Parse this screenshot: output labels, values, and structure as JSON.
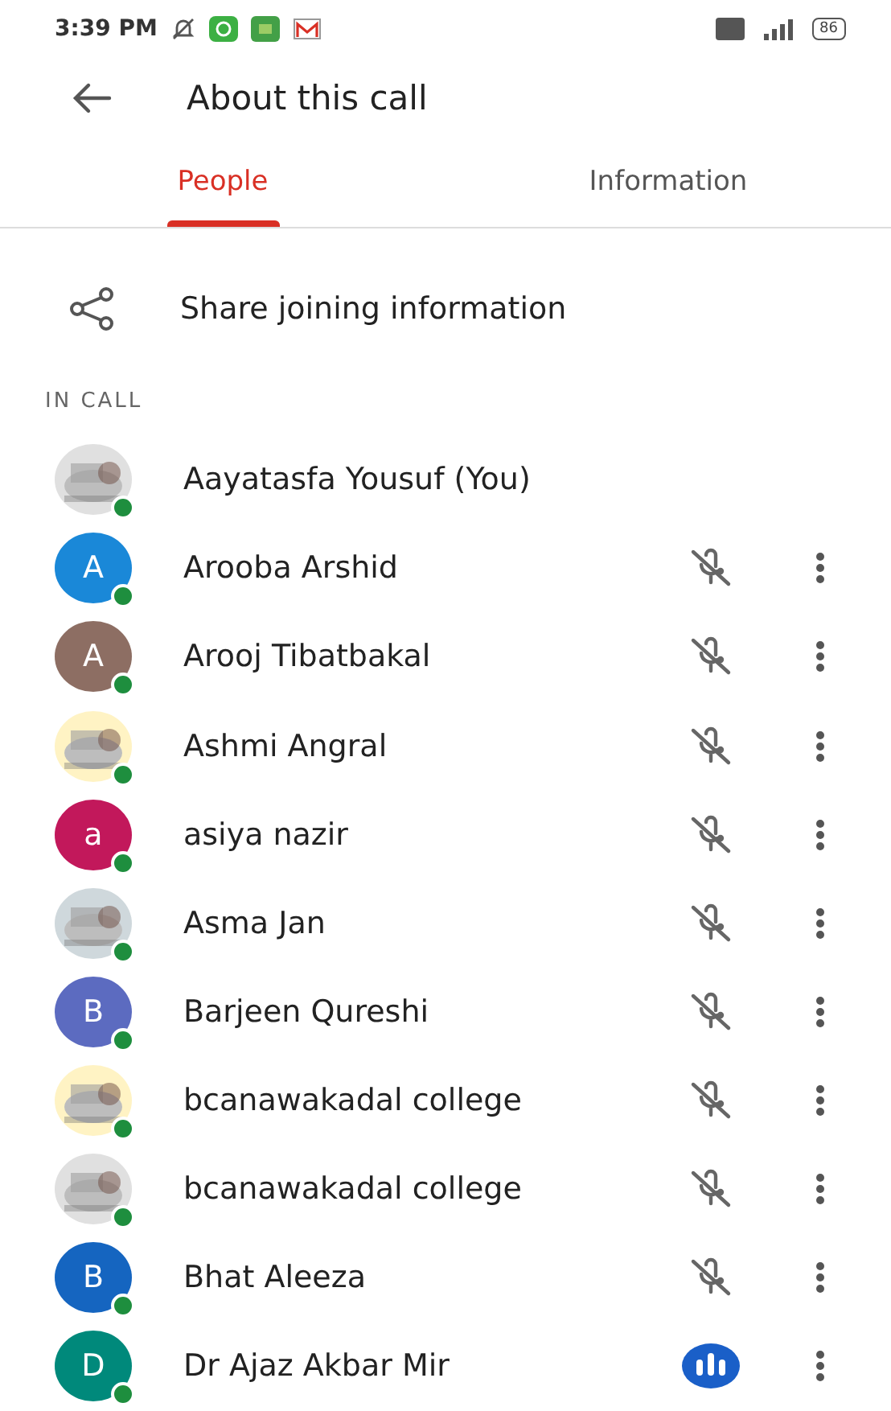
{
  "status_bar": {
    "time": "3:39 PM",
    "battery": "86"
  },
  "header": {
    "title": "About this call"
  },
  "tabs": [
    {
      "label": "People",
      "selected": true
    },
    {
      "label": "Information",
      "selected": false
    }
  ],
  "share": {
    "label": "Share joining information"
  },
  "section": {
    "label": "IN CALL"
  },
  "people": [
    {
      "name": "Aayatasfa Yousuf (You)",
      "muted": false,
      "speaking": false,
      "menu": false
    },
    {
      "name": "Arooba Arshid",
      "avatar": {
        "kind": "letter",
        "letter": "A",
        "color": "#1a88d8"
      },
      "muted": true,
      "speaking": false,
      "menu": true
    },
    {
      "name": "Arooj Tibatbakal",
      "avatar": {
        "kind": "letter",
        "letter": "A",
        "color": "#8d6e63"
      },
      "muted": true,
      "speaking": false,
      "menu": true
    },
    {
      "name": "Ashmi Angral",
      "muted": true,
      "speaking": false,
      "menu": true
    },
    {
      "name": "asiya nazir",
      "avatar": {
        "kind": "letter",
        "letter": "a",
        "color": "#c2185b"
      },
      "muted": true,
      "speaking": false,
      "menu": true
    },
    {
      "name": "Asma Jan",
      "muted": true,
      "speaking": false,
      "menu": true
    },
    {
      "name": "Barjeen Qureshi",
      "avatar": {
        "kind": "letter",
        "letter": "B",
        "color": "#5c6bc0"
      },
      "muted": true,
      "speaking": false,
      "menu": true
    },
    {
      "name": "bcanawakadal college",
      "muted": true,
      "speaking": false,
      "menu": true
    },
    {
      "name": "bcanawakadal college",
      "muted": true,
      "speaking": false,
      "menu": true
    },
    {
      "name": "Bhat Aleeza",
      "avatar": {
        "kind": "letter",
        "letter": "B",
        "color": "#1565c0"
      },
      "muted": true,
      "speaking": false,
      "menu": true
    },
    {
      "name": "Dr Ajaz Akbar Mir",
      "avatar": {
        "kind": "letter",
        "letter": "D",
        "color": "#00897b"
      },
      "muted": false,
      "speaking": true,
      "menu": true
    }
  ]
}
